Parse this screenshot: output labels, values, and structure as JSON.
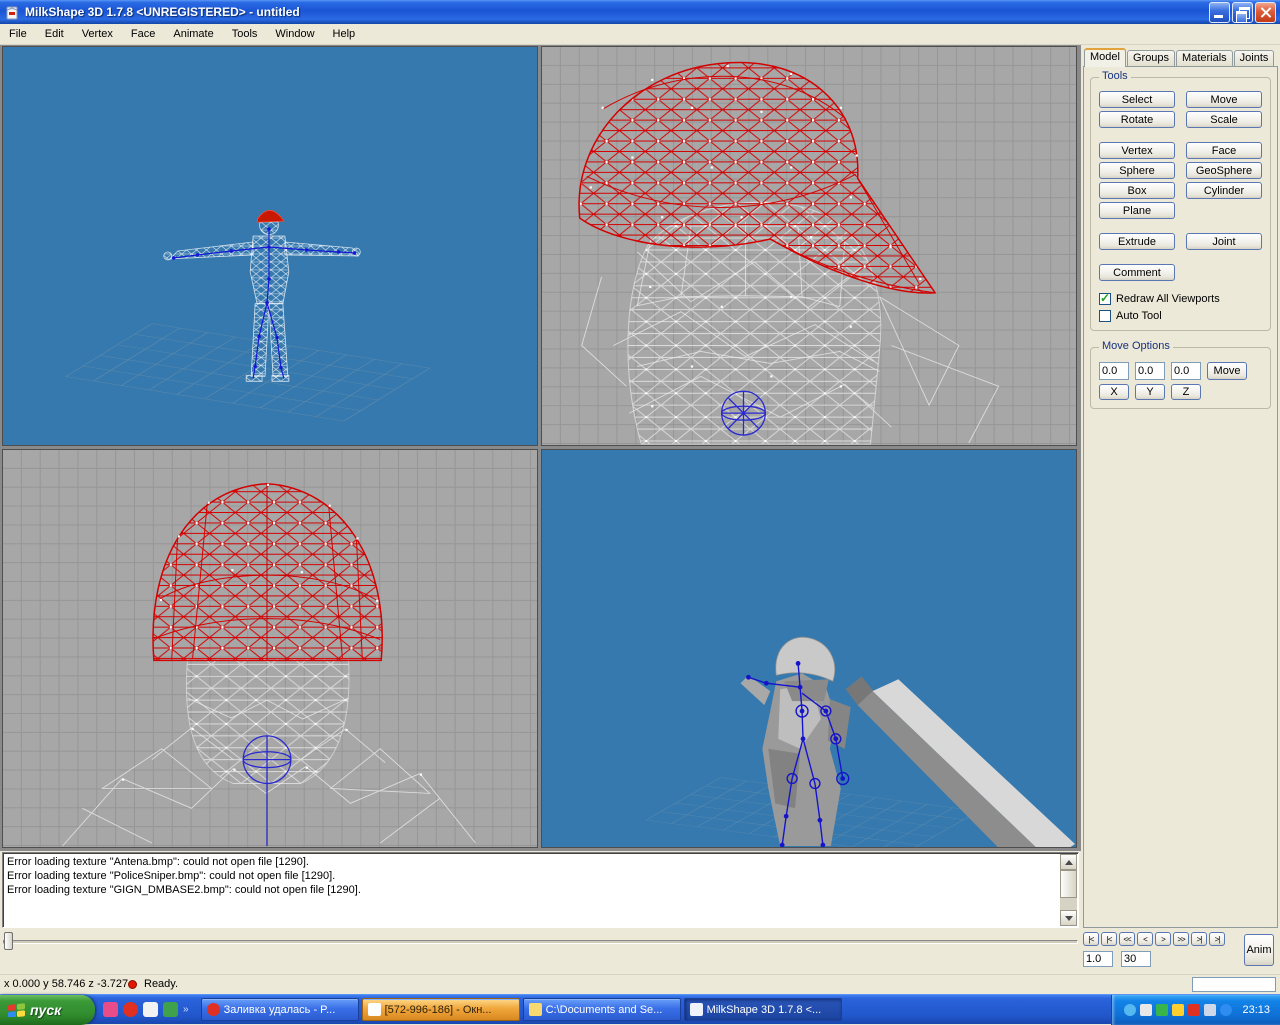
{
  "window": {
    "title": "MilkShape 3D 1.7.8 <UNREGISTERED> - untitled"
  },
  "menubar": {
    "items": [
      "File",
      "Edit",
      "Vertex",
      "Face",
      "Animate",
      "Tools",
      "Window",
      "Help"
    ]
  },
  "side_panel": {
    "tabs": [
      {
        "label": "Model",
        "active": true
      },
      {
        "label": "Groups",
        "active": false
      },
      {
        "label": "Materials",
        "active": false
      },
      {
        "label": "Joints",
        "active": false
      }
    ],
    "tools": {
      "group_label": "Tools",
      "buttons": [
        "Select",
        "Move",
        "Rotate",
        "Scale",
        "Vertex",
        "Face",
        "Sphere",
        "GeoSphere",
        "Box",
        "Cylinder",
        "Plane",
        "Extrude",
        "Joint",
        "Comment"
      ],
      "checkboxes": [
        {
          "label": "Redraw All Viewports",
          "checked": true
        },
        {
          "label": "Auto Tool",
          "checked": false
        }
      ]
    },
    "move_options": {
      "group_label": "Move Options",
      "fields": {
        "x": "0.0",
        "y": "0.0",
        "z": "0.0"
      },
      "move_button": "Move",
      "axis_buttons": [
        "X",
        "Y",
        "Z"
      ]
    }
  },
  "message_log": {
    "lines": [
      "Error loading texture \"Antena.bmp\": could not open file [1290].",
      "Error loading texture \"PoliceSniper.bmp\": could not open file [1290].",
      "Error loading texture \"GIGN_DMBASE2.bmp\": could not open file [1290]."
    ]
  },
  "anim_controls": {
    "buttons": [
      "|<",
      "|<",
      "<<",
      "<",
      ">",
      ">>",
      ">|",
      ">|"
    ],
    "frame_current": "1.0",
    "total_frames": "30",
    "anim_button": "Anim"
  },
  "status_bar": {
    "coordinates": "x 0.000 y 58.746 z -3.727",
    "message": "Ready."
  },
  "taskbar": {
    "start_label": "пуск",
    "tasks": [
      {
        "label": "Заливка удалась - P..."
      },
      {
        "label": "[572-996-186] - Окн..."
      },
      {
        "label": "C:\\Documents and Se..."
      },
      {
        "label": "MilkShape 3D 1.7.8 <..."
      }
    ],
    "tray_clock": "23:13"
  }
}
